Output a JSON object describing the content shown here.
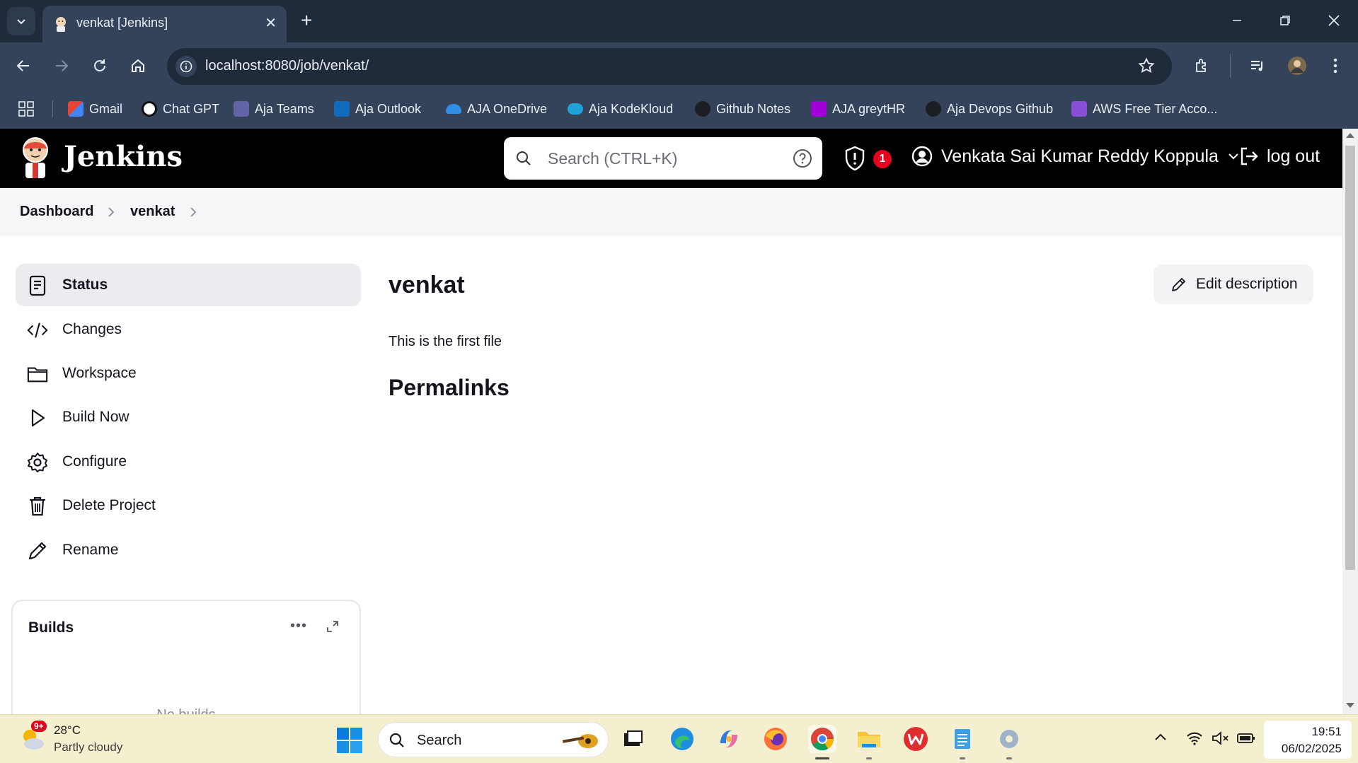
{
  "browser": {
    "tab_title": "venkat [Jenkins]",
    "url": "localhost:8080/job/venkat/",
    "bookmarks": [
      "Gmail",
      "Chat GPT",
      "Aja Teams",
      "Aja Outlook",
      "AJA OneDrive",
      "Aja KodeKloud",
      "Github Notes",
      "AJA greytHR",
      "Aja Devops Github",
      "AWS Free Tier Acco..."
    ]
  },
  "header": {
    "brand": "Jenkins",
    "search_placeholder": "Search (CTRL+K)",
    "notification_count": "1",
    "user_name": "Venkata Sai Kumar Reddy Koppula",
    "logout_label": "log out"
  },
  "breadcrumb": {
    "items": [
      "Dashboard",
      "venkat"
    ]
  },
  "sidebar": {
    "items": [
      {
        "label": "Status",
        "icon": "status-icon",
        "active": true
      },
      {
        "label": "Changes",
        "icon": "code-icon"
      },
      {
        "label": "Workspace",
        "icon": "folder-icon"
      },
      {
        "label": "Build Now",
        "icon": "play-icon"
      },
      {
        "label": "Configure",
        "icon": "gear-icon"
      },
      {
        "label": "Delete Project",
        "icon": "trash-icon"
      },
      {
        "label": "Rename",
        "icon": "pencil-icon"
      }
    ]
  },
  "builds": {
    "title": "Builds",
    "empty_text": "No builds"
  },
  "main": {
    "title": "venkat",
    "edit_label": "Edit description",
    "description": "This is the first file",
    "permalinks_heading": "Permalinks"
  },
  "taskbar": {
    "weather_badge": "9+",
    "temperature": "28°C",
    "condition": "Partly cloudy",
    "search_label": "Search",
    "time": "19:51",
    "date": "06/02/2025"
  },
  "colors": {
    "chrome_dark": "#1f2a3b",
    "chrome_mid": "#34425a",
    "jenkins_header": "#000000",
    "badge_red": "#e6001f",
    "taskbar": "#f4f0cf"
  }
}
